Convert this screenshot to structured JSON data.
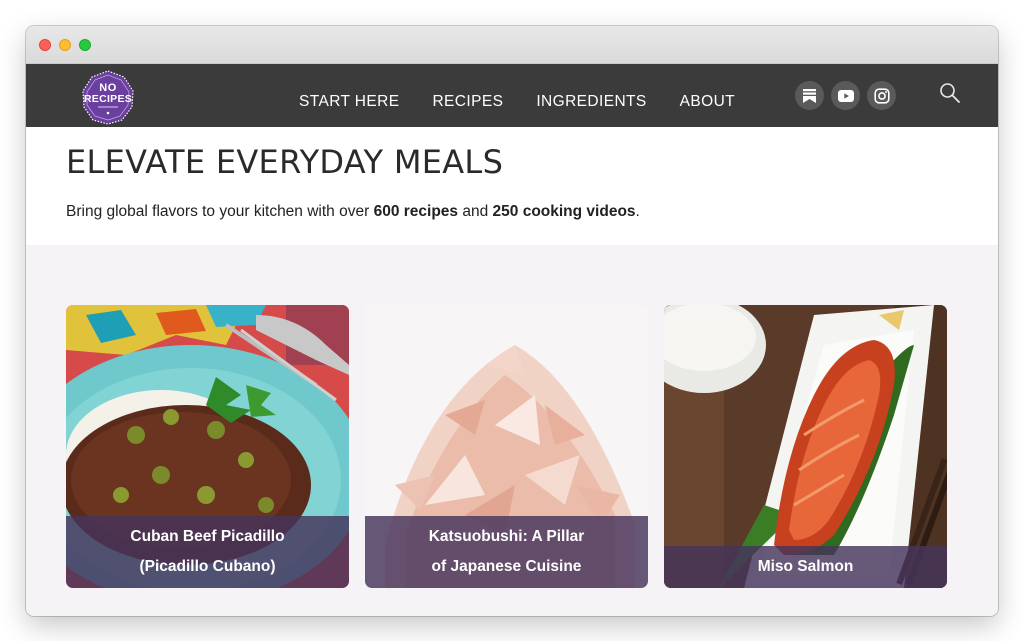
{
  "brand": {
    "logo_top": "NO",
    "logo_main": "RECIPES",
    "accent": "#6b3fa0",
    "caption_bg": "#46345c"
  },
  "nav": {
    "links": [
      "START HERE",
      "RECIPES",
      "INGREDIENTS",
      "ABOUT"
    ],
    "social_icons": [
      "bookmark-icon",
      "youtube-icon",
      "instagram-icon"
    ],
    "search_icon": "search-icon"
  },
  "hero": {
    "title": "ELEVATE EVERYDAY MEALS",
    "sub_prefix": "Bring global flavors to your kitchen with over ",
    "sub_recipes": "600 recipes",
    "sub_and": " and ",
    "sub_videos": "250 cooking videos",
    "sub_suffix": "."
  },
  "cards": [
    {
      "line1": "Cuban Beef Picadillo",
      "line2": "(Picadillo Cubano)"
    },
    {
      "line1": "Katsuobushi: A Pillar",
      "line2": "of Japanese Cuisine"
    },
    {
      "line1": "Miso Salmon",
      "line2": ""
    }
  ]
}
